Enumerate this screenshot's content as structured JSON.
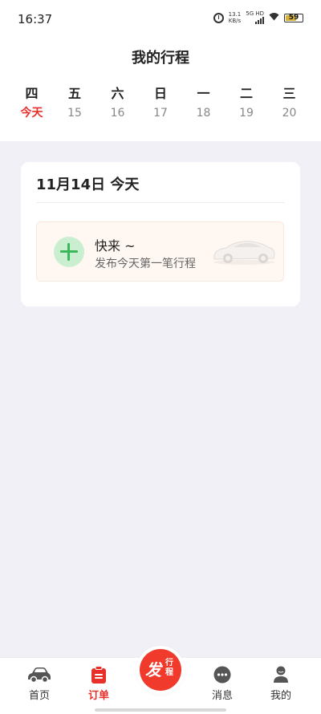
{
  "status_bar": {
    "time": "16:37",
    "speed_value": "13.1",
    "speed_unit": "KB/s",
    "network": "5G HD",
    "battery": "59"
  },
  "header": {
    "title": "我的行程"
  },
  "calendar": {
    "days": [
      {
        "weekday": "四",
        "date": "今天",
        "active": true
      },
      {
        "weekday": "五",
        "date": "15"
      },
      {
        "weekday": "六",
        "date": "16"
      },
      {
        "weekday": "日",
        "date": "17"
      },
      {
        "weekday": "一",
        "date": "18"
      },
      {
        "weekday": "二",
        "date": "19"
      },
      {
        "weekday": "三",
        "date": "20"
      }
    ]
  },
  "card": {
    "date_title": "11月14日 今天",
    "prompt_title": "快来 ~",
    "prompt_subtitle": "发布今天第一笔行程"
  },
  "nav": {
    "home": "首页",
    "orders": "订单",
    "publish_big": "发",
    "publish_small": "行程",
    "messages": "消息",
    "mine": "我的"
  },
  "colors": {
    "accent": "#e8302a",
    "plus_green": "#3ab85a",
    "background": "#f1f0f6"
  }
}
